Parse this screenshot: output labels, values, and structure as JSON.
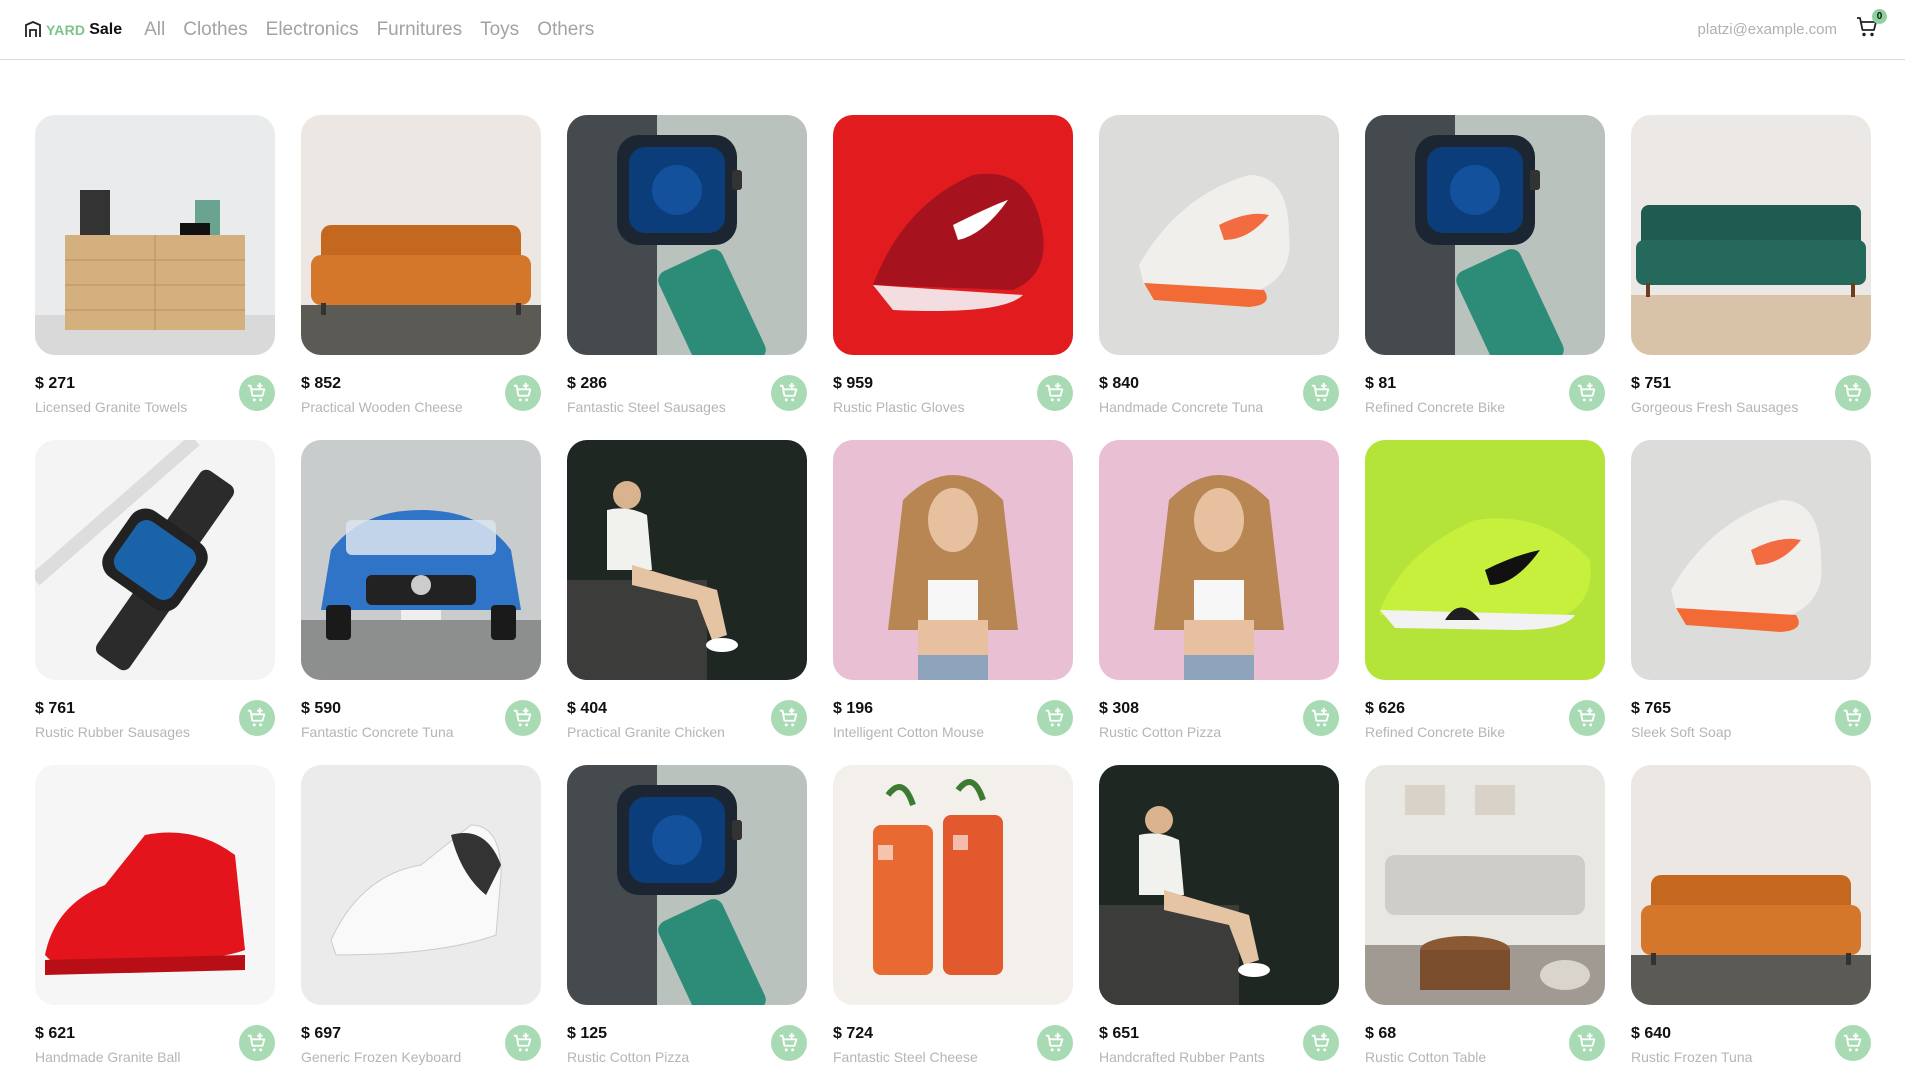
{
  "brand": {
    "yard": "YARD",
    "sale": "Sale"
  },
  "nav": [
    "All",
    "Clothes",
    "Electronics",
    "Furnitures",
    "Toys",
    "Others"
  ],
  "user": {
    "email": "platzi@example.com",
    "cart_count": "0"
  },
  "products": [
    {
      "price": "$ 271",
      "title": "Licensed Granite Towels",
      "image": "dresser"
    },
    {
      "price": "$ 852",
      "title": "Practical Wooden Cheese",
      "image": "orange-sofa"
    },
    {
      "price": "$ 286",
      "title": "Fantastic Steel Sausages",
      "image": "smartwatch-green"
    },
    {
      "price": "$ 959",
      "title": "Rustic Plastic Gloves",
      "image": "red-sneaker"
    },
    {
      "price": "$ 840",
      "title": "Handmade Concrete Tuna",
      "image": "white-orange-sneaker"
    },
    {
      "price": "$ 81",
      "title": "Refined Concrete Bike",
      "image": "smartwatch-green"
    },
    {
      "price": "$ 751",
      "title": "Gorgeous Fresh Sausages",
      "image": "green-sofa"
    },
    {
      "price": "$ 761",
      "title": "Rustic Rubber Sausages",
      "image": "smartwatch-black"
    },
    {
      "price": "$ 590",
      "title": "Fantastic Concrete Tuna",
      "image": "blue-car"
    },
    {
      "price": "$ 404",
      "title": "Practical Granite Chicken",
      "image": "woman-sitting"
    },
    {
      "price": "$ 196",
      "title": "Intelligent Cotton Mouse",
      "image": "woman-pink"
    },
    {
      "price": "$ 308",
      "title": "Rustic Cotton Pizza",
      "image": "woman-pink"
    },
    {
      "price": "$ 626",
      "title": "Refined Concrete Bike",
      "image": "lime-sneaker"
    },
    {
      "price": "$ 765",
      "title": "Sleek Soft Soap",
      "image": "white-orange-sneaker"
    },
    {
      "price": "$ 621",
      "title": "Handmade Granite Ball",
      "image": "red-highshoe"
    },
    {
      "price": "$ 697",
      "title": "Generic Frozen Keyboard",
      "image": "white-shoe"
    },
    {
      "price": "$ 125",
      "title": "Rustic Cotton Pizza",
      "image": "smartwatch-green"
    },
    {
      "price": "$ 724",
      "title": "Fantastic Steel Cheese",
      "image": "iced-drinks"
    },
    {
      "price": "$ 651",
      "title": "Handcrafted Rubber Pants",
      "image": "woman-sitting"
    },
    {
      "price": "$ 68",
      "title": "Rustic Cotton Table",
      "image": "living-room"
    },
    {
      "price": "$ 640",
      "title": "Rustic Frozen Tuna",
      "image": "orange-sofa"
    }
  ],
  "colors": {
    "accent": "#7cc48a",
    "button": "#a8dbb4",
    "muted": "#b5b5b5"
  }
}
